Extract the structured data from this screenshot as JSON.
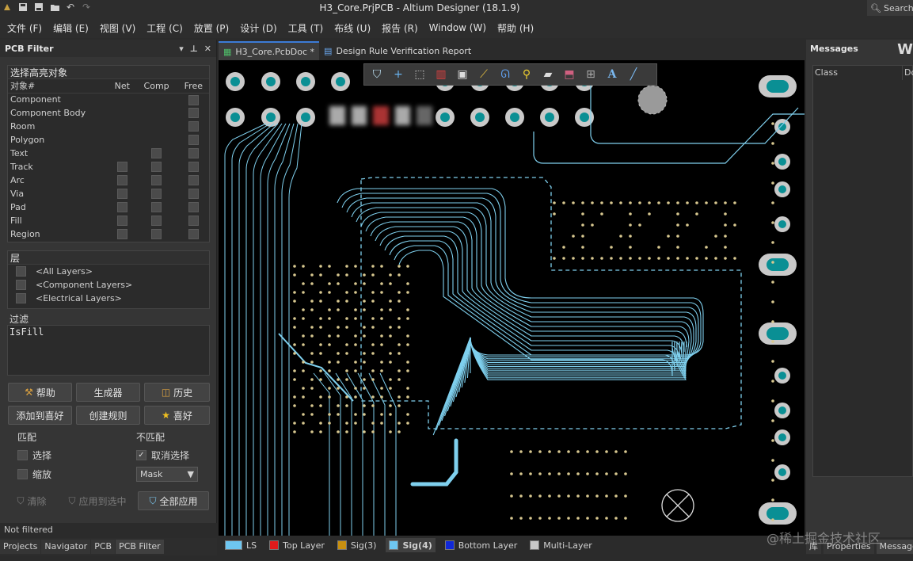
{
  "window": {
    "title": "H3_Core.PrjPCB - Altium Designer (18.1.9)",
    "search": "Search"
  },
  "quick_access": [
    "app-icon",
    "save-icon",
    "save-all-icon",
    "open-folder-icon",
    "undo-icon",
    "redo-icon"
  ],
  "menu": [
    "文件 (F)",
    "编辑 (E)",
    "视图 (V)",
    "工程 (C)",
    "放置 (P)",
    "设计 (D)",
    "工具 (T)",
    "布线 (U)",
    "报告 (R)",
    "Window (W)",
    "帮助 (H)"
  ],
  "pcb_filter": {
    "title": "PCB Filter",
    "highlight_header": "选择高亮对象",
    "columns": [
      "对象#",
      "Net",
      "Comp",
      "Free"
    ],
    "objects": [
      {
        "name": "Component",
        "net": false,
        "comp": false,
        "free": true
      },
      {
        "name": "Component Body",
        "net": false,
        "comp": false,
        "free": true
      },
      {
        "name": "Room",
        "net": false,
        "comp": false,
        "free": true
      },
      {
        "name": "Polygon",
        "net": false,
        "comp": false,
        "free": true
      },
      {
        "name": "Text",
        "net": false,
        "comp": true,
        "free": true
      },
      {
        "name": "Track",
        "net": true,
        "comp": true,
        "free": true
      },
      {
        "name": "Arc",
        "net": true,
        "comp": true,
        "free": true
      },
      {
        "name": "Via",
        "net": true,
        "comp": true,
        "free": true
      },
      {
        "name": "Pad",
        "net": true,
        "comp": true,
        "free": true
      },
      {
        "name": "Fill",
        "net": true,
        "comp": true,
        "free": true
      },
      {
        "name": "Region",
        "net": true,
        "comp": true,
        "free": true
      }
    ],
    "layers_header": "层",
    "layers": [
      "<All Layers>",
      "<Component Layers>",
      "<Electrical Layers>"
    ],
    "filter_label": "过滤",
    "filter_text": "IsFill",
    "buttons": {
      "help": "帮助",
      "builder": "生成器",
      "history": "历史",
      "add_fav": "添加到喜好",
      "create_rule": "创建规则",
      "favorites": "喜好"
    },
    "match_label": "匹配",
    "nomatch_label": "不匹配",
    "match_select": "选择",
    "match_zoom": "缩放",
    "nomatch_deselect": "取消选择",
    "mask_value": "Mask",
    "clear": "清除",
    "apply_selected": "应用到选中",
    "apply_all": "全部应用",
    "status": "Not filtered"
  },
  "panel_tabs": [
    "Projects",
    "Navigator",
    "PCB",
    "PCB Filter"
  ],
  "doc_tabs": [
    {
      "label": "H3_Core.PcbDoc *",
      "active": true
    },
    {
      "label": "Design Rule Verification Report",
      "active": false
    }
  ],
  "layer_tabs": [
    {
      "label": "LS",
      "color": "#6ec6f0"
    },
    {
      "label": "Top Layer",
      "color": "#e01b1b"
    },
    {
      "label": "Sig(3)",
      "color": "#c89010"
    },
    {
      "label": "Sig(4)",
      "color": "#6ec6f0",
      "active": true
    },
    {
      "label": "Bottom Layer",
      "color": "#1028d8"
    },
    {
      "label": "Multi-Layer",
      "color": "#c8c8c8"
    }
  ],
  "messages": {
    "title": "Messages",
    "columns": [
      "Class",
      "Do"
    ],
    "bottom_tabs": [
      "库",
      "Properties",
      "Messages"
    ]
  },
  "watermark": "@稀土掘金技术社区"
}
